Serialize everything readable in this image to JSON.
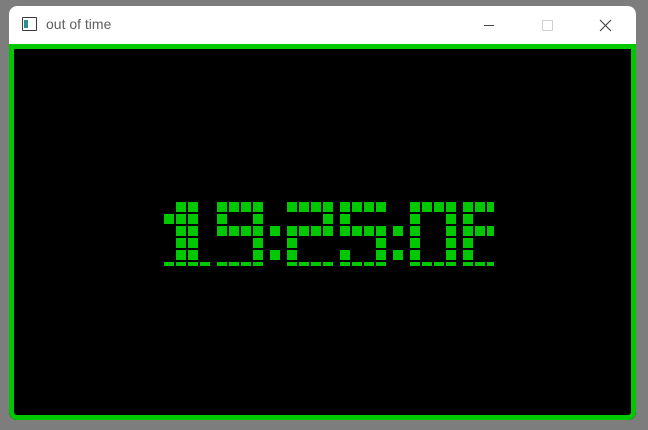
{
  "window": {
    "title": "out of time",
    "app_icon": "window-app-icon",
    "controls": {
      "minimize": "minimize-icon",
      "maximize": "maximize-icon",
      "close": "close-icon"
    }
  },
  "clock": {
    "time": "19:25:06",
    "color": "#00c800",
    "background": "#000000"
  },
  "colors": {
    "frame_border": "#00c800"
  }
}
